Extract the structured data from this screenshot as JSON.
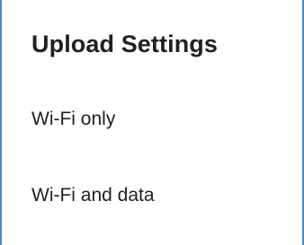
{
  "dialog": {
    "title": "Upload Settings",
    "options": [
      {
        "label": "Wi-Fi only"
      },
      {
        "label": "Wi-Fi and data"
      }
    ]
  },
  "colors": {
    "frame_border": "#4a86c8",
    "text": "#202124",
    "background": "#ffffff"
  }
}
